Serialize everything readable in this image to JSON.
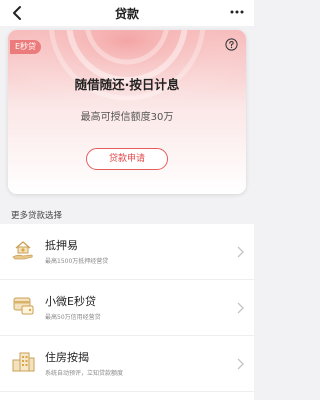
{
  "header": {
    "title": "贷款"
  },
  "hero": {
    "badge": "E秒贷",
    "title": "随借随还·按日计息",
    "subtitle": "最高可授信额度30万",
    "apply_label": "贷款申请",
    "accent_color": "#e24a4a"
  },
  "section": {
    "title": "更多贷款选择"
  },
  "products": [
    {
      "name": "抵押易",
      "desc": "最高1500万抵押经营贷",
      "icon": "house-hand-icon"
    },
    {
      "name": "小微E秒贷",
      "desc": "最高50万信用经营贷",
      "icon": "wallet-card-icon"
    },
    {
      "name": "住房按揭",
      "desc": "系统自动预评，立知贷款额度",
      "icon": "buildings-icon"
    }
  ]
}
